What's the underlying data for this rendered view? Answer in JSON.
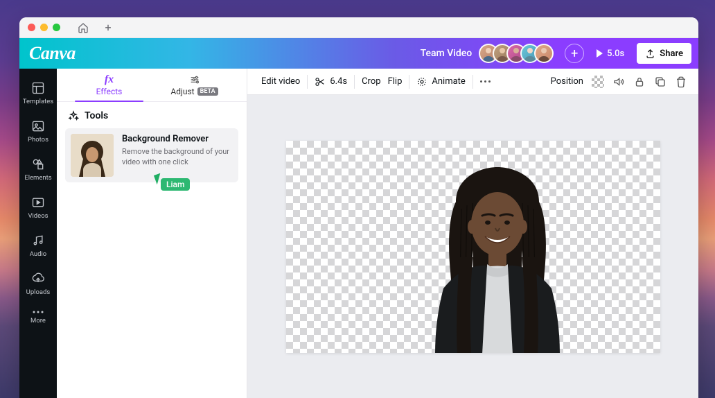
{
  "header": {
    "logo": "Canva",
    "project_name": "Team Video",
    "play_duration": "5.0s",
    "share_label": "Share",
    "collaborators": 5
  },
  "rail": {
    "items": [
      {
        "label": "Templates",
        "icon": "templates-icon"
      },
      {
        "label": "Photos",
        "icon": "photos-icon"
      },
      {
        "label": "Elements",
        "icon": "elements-icon"
      },
      {
        "label": "Videos",
        "icon": "videos-icon"
      },
      {
        "label": "Audio",
        "icon": "audio-icon"
      },
      {
        "label": "Uploads",
        "icon": "uploads-icon"
      },
      {
        "label": "More",
        "icon": "more-icon"
      }
    ]
  },
  "panel": {
    "tabs": [
      {
        "label": "Effects",
        "active": true
      },
      {
        "label": "Adjust",
        "badge": "BETA",
        "active": false
      }
    ],
    "tools_heading": "Tools",
    "tool": {
      "title": "Background Remover",
      "description": "Remove the background of your video with one click"
    },
    "collaborator_cursor": "Liam"
  },
  "context_bar": {
    "edit_video": "Edit video",
    "trim_duration": "6.4s",
    "crop": "Crop",
    "flip": "Flip",
    "animate": "Animate",
    "position": "Position"
  },
  "colors": {
    "accent": "#8b3dff",
    "header_gradient_start": "#00c4cc",
    "header_gradient_end": "#8b3dff",
    "collab_cursor": "#2db872",
    "rail_bg": "#0d1216"
  }
}
